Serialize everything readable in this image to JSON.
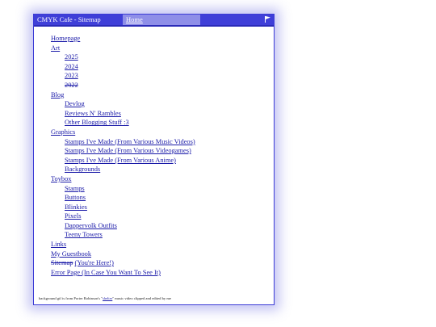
{
  "window": {
    "title": "CMYK Cafe - Sitemap",
    "home_link": "Home",
    "flag_icon": "flag-icon"
  },
  "nav": {
    "homepage": "Homepage",
    "art": {
      "label": "Art",
      "items": [
        "2025",
        "2024",
        "2023",
        "2022"
      ]
    },
    "blog": {
      "label": "Blog",
      "items": [
        "Devlog",
        "Reviews N' Rambles",
        "Other Blogging Stuff :3"
      ]
    },
    "graphics": {
      "label": "Graphics",
      "items": [
        "Stamps I've Made (From Various Music Videos)",
        "Stamps I've Made (From Various Videogames)",
        "Stamps I've Made (From Various Anime)",
        "Backgrounds"
      ]
    },
    "toybox": {
      "label": "Toybox",
      "items": [
        "Stamps",
        "Buttons",
        "Blinkies",
        "Pixels",
        "Dappervolk Outfits",
        "Teeny Towers"
      ]
    },
    "links": "Links",
    "guestbook": "My Guestbook",
    "sitemap_strike": "Sitemap",
    "sitemap_note": "(You're Here!)",
    "error_page": "Error Page (In Case You Want To See It)"
  },
  "footer": {
    "text_before": "background gif is from Porter Robinson's \"",
    "link": "shelter",
    "text_after": "\" music video clipped and edited by me"
  },
  "colors": {
    "titlebar": "#3f3fd8",
    "home_tab": "#8f8fe8",
    "link": "#1a1aa8",
    "glow": "#5050dc"
  }
}
